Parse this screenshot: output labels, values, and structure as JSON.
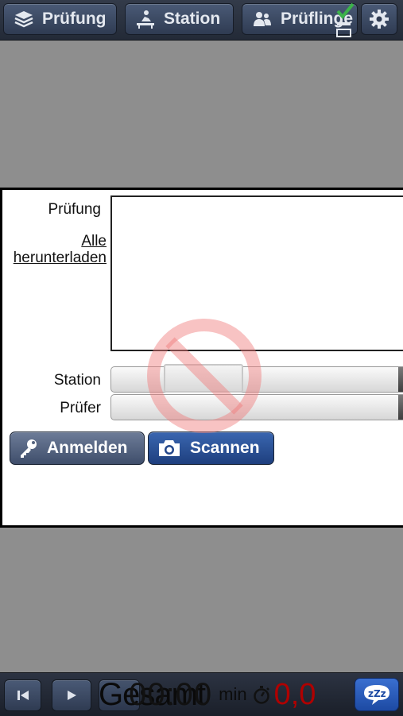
{
  "toolbar": {
    "exam_label": "Prüfung",
    "station_label": "Station",
    "candidates_label": "Prüflinge"
  },
  "dialog": {
    "exam_label": "Prüfung",
    "download_all_link": "Alle herunterladen",
    "station_label": "Station",
    "examiner_label": "Prüfer",
    "login_button": "Anmelden",
    "scan_button": "Scannen"
  },
  "bottom": {
    "total_label": "Gesamt",
    "time_value": "00:00",
    "unit": "min",
    "score": "0,0"
  },
  "icons": {
    "exam": "layers-icon",
    "station": "station-icon",
    "candidates": "people-icon",
    "settings": "gear-icon",
    "check": "checkmark-icon",
    "login": "key-icon",
    "scan": "camera-icon",
    "first": "skip-back-icon",
    "play": "play-icon",
    "stopwatch": "stopwatch-icon",
    "sleep": "sleep-zzz-icon",
    "disabled": "no-entry-icon"
  },
  "colors": {
    "accent_blue": "#2a52a0",
    "score_red": "#b00000"
  }
}
